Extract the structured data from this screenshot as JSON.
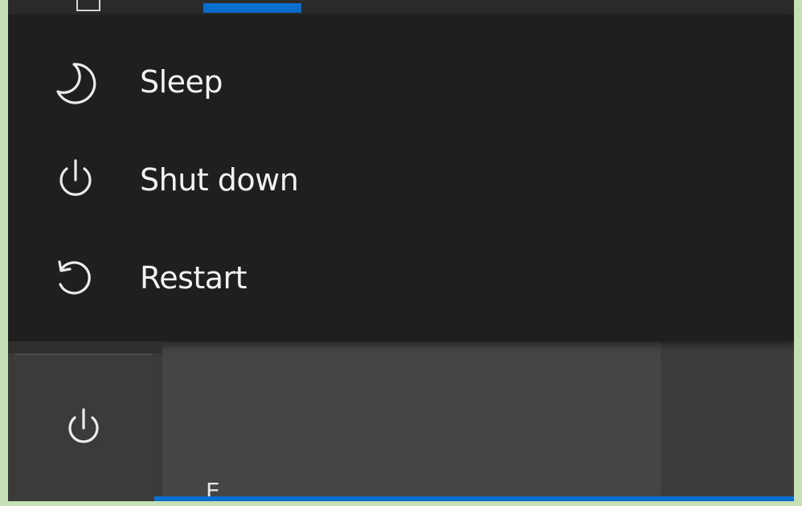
{
  "power_menu": {
    "items": [
      {
        "label": "Sleep",
        "icon": "sleep-moon-icon"
      },
      {
        "label": "Shut down",
        "icon": "power-icon"
      },
      {
        "label": "Restart",
        "icon": "restart-icon"
      }
    ]
  },
  "power_button": {
    "icon": "power-icon"
  },
  "taskbar": {
    "partial_glyph": "E"
  },
  "colors": {
    "flyout_background": "#1f1f1f",
    "menu_text": "#f2f2f2",
    "accent": "#0a6fcf",
    "outer_frame": "#c5e0b4"
  }
}
